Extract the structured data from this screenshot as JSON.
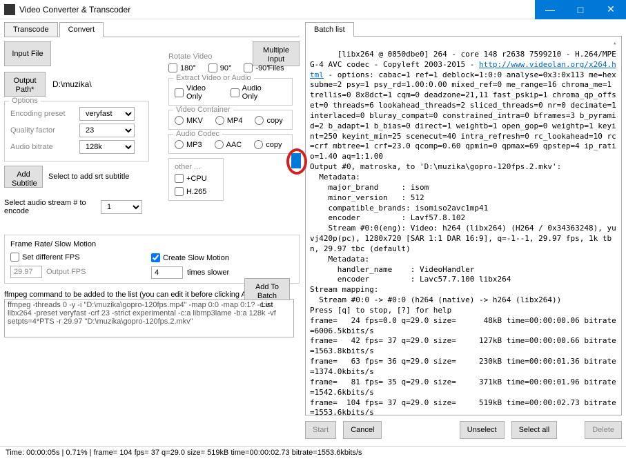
{
  "window": {
    "title": "Video Converter & Transcoder",
    "min": "—",
    "max": "□",
    "close": "✕"
  },
  "tabs": {
    "transcode": "Transcode",
    "convert": "Convert"
  },
  "buttons": {
    "inputFile": "Input File",
    "multiInput": "Multiple Input Files",
    "outputPath": "Output Path*",
    "addSub": "Add Subtitle",
    "addBatch": "Add To Batch List",
    "start": "Start",
    "cancel": "Cancel",
    "unselect": "Unselect",
    "selectAll": "Select all",
    "delete": "Delete"
  },
  "outputPathValue": "D:\\muzika\\",
  "options": {
    "legend": "Options",
    "encodingPresetLabel": "Encoding preset",
    "encodingPreset": "veryfast",
    "qualityFactorLabel": "Quality factor",
    "qualityFactor": "23",
    "audioBitrateLabel": "Audio bitrate",
    "audioBitrate": "128k"
  },
  "rotate": {
    "label": "Rotate Video",
    "r180": "180°",
    "r90": "90°",
    "rn90": "-90°"
  },
  "extract": {
    "label": "Extract Video or Audio",
    "videoOnly": "Video Only",
    "audioOnly": "Audio Only"
  },
  "vcontainer": {
    "label": "Video Container",
    "mkv": "MKV",
    "mp4": "MP4",
    "copy": "copy"
  },
  "acodec": {
    "label": "Audio Codec",
    "mp3": "MP3",
    "aac": "AAC",
    "copy": "copy"
  },
  "other": {
    "label": "other ...",
    "cpu": "+CPU",
    "h265": "H.265"
  },
  "subtitle": {
    "hint": "Select to add srt subtitle"
  },
  "audioStream": {
    "label": "Select audio stream # to encode",
    "value": "1"
  },
  "fps": {
    "legend": "Frame Rate/ Slow Motion",
    "setDifferent": "Set different FPS",
    "fpsValue": "29.97",
    "outputLabel": "Output FPS",
    "slowMotion": "Create Slow Motion",
    "slowValue": "4",
    "slowLabel": "times slower"
  },
  "ffmpeg": {
    "label": "ffmpeg command to be added to the list (you can edit it before clicking Add):",
    "cmd": "ffmpeg -threads 0 -y -i \"D:\\muzika\\gopro-120fps.mp4\" -map 0:0 -map 0:1? -c:v libx264 -preset veryfast -crf 23 -strict experimental -c:a libmp3lame -b:a 128k -vf setpts=4*PTS -r 29.97 \"D:\\muzika\\gopro-120fps.2.mkv\""
  },
  "batch": {
    "tab": "Batch list",
    "log_pre": "[libx264 @ 0850dbe0] 264 - core 148 r2638 7599210 - H.264/MPEG-4 AVC codec - Copyleft 2003-2015 - ",
    "log_link": "http://www.videolan.org/x264.html",
    "log_post": " - options: cabac=1 ref=1 deblock=1:0:0 analyse=0x3:0x113 me=hex subme=2 psy=1 psy_rd=1.00:0.00 mixed_ref=0 me_range=16 chroma_me=1 trellis=0 8x8dct=1 cqm=0 deadzone=21,11 fast_pskip=1 chroma_qp_offset=0 threads=6 lookahead_threads=2 sliced_threads=0 nr=0 decimate=1 interlaced=0 bluray_compat=0 constrained_intra=0 bframes=3 b_pyramid=2 b_adapt=1 b_bias=0 direct=1 weightb=1 open_gop=0 weightp=1 keyint=250 keyint_min=25 scenecut=40 intra_refresh=0 rc_lookahead=10 rc=crf mbtree=1 crf=23.0 qcomp=0.60 qpmin=0 qpmax=69 qpstep=4 ip_ratio=1.40 aq=1:1.00\nOutput #0, matroska, to 'D:\\muzika\\gopro-120fps.2.mkv':\n  Metadata:\n    major_brand     : isom\n    minor_version   : 512\n    compatible_brands: isomiso2avc1mp41\n    encoder         : Lavf57.8.102\n    Stream #0:0(eng): Video: h264 (libx264) (H264 / 0x34363248), yuvj420p(pc), 1280x720 [SAR 1:1 DAR 16:9], q=-1--1, 29.97 fps, 1k tbn, 29.97 tbc (default)\n    Metadata:\n      handler_name    : VideoHandler\n      encoder         : Lavc57.7.100 libx264\nStream mapping:\n  Stream #0:0 -> #0:0 (h264 (native) -> h264 (libx264))\nPress [q] to stop, [?] for help\nframe=   24 fps=0.0 q=29.0 size=      48kB time=00:00:00.06 bitrate=6006.5kbits/s\nframe=   42 fps= 37 q=29.0 size=     127kB time=00:00:00.66 bitrate=1563.8kbits/s\nframe=   63 fps= 36 q=29.0 size=     230kB time=00:00:01.36 bitrate=1374.0kbits/s\nframe=   81 fps= 35 q=29.0 size=     371kB time=00:00:01.96 bitrate=1542.6kbits/s\nframe=  104 fps= 37 q=29.0 size=     519kB time=00:00:02.73 bitrate=1553.6kbits/s"
  },
  "status": "Time: 00:00:05s |  0.71% |  frame=  104 fps= 37 q=29.0 size=     519kB time=00:00:02.73 bitrate=1553.6kbits/s"
}
